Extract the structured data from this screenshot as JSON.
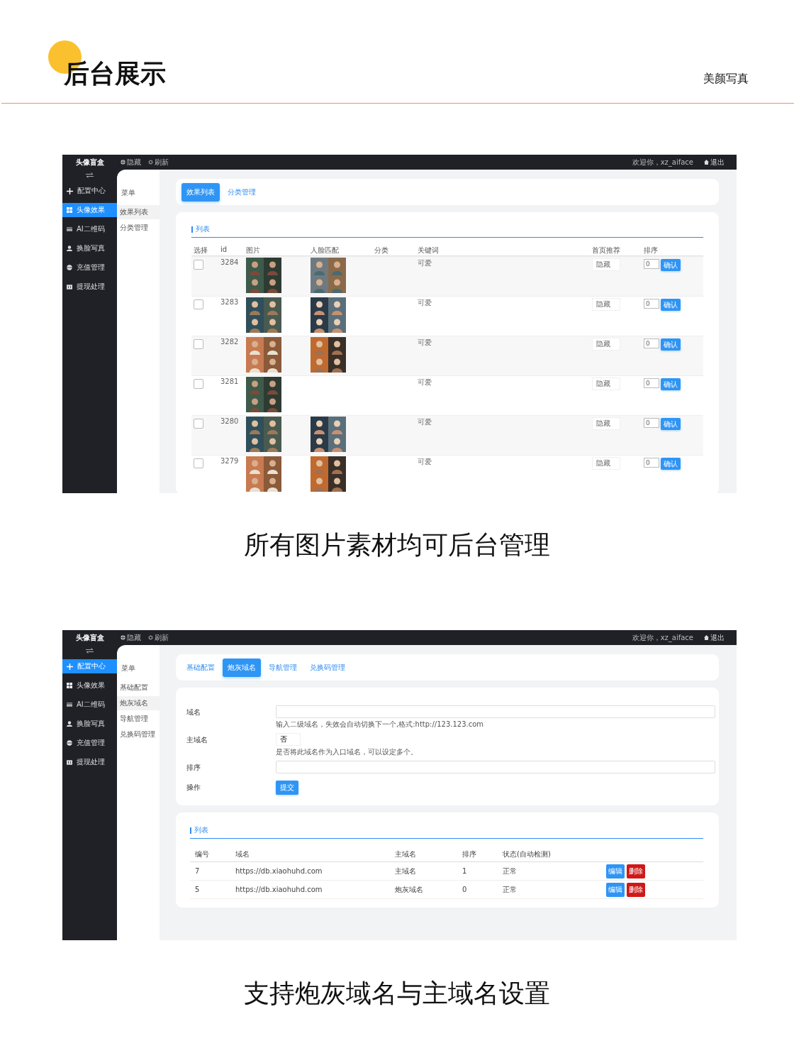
{
  "header": {
    "title": "后台展示",
    "tag": "美颜写真"
  },
  "sections": [
    {
      "caption": "所有图片素材均可后台管理",
      "screen": {
        "brand": "头像盲盒",
        "toolbar": [
          "隐藏",
          "刷新"
        ],
        "welcome": "欢迎你，xz_aiface",
        "logout": "退出",
        "sidebar": [
          {
            "label": "配置中心",
            "selected": false
          },
          {
            "label": "头像效果",
            "selected": true
          },
          {
            "label": "AI二维码",
            "selected": false
          },
          {
            "label": "换脸写真",
            "selected": false
          },
          {
            "label": "充值管理",
            "selected": false
          },
          {
            "label": "提现处理",
            "selected": false
          }
        ],
        "submenu": {
          "title": "菜单",
          "items": [
            {
              "label": "效果列表",
              "selected": true
            },
            {
              "label": "分类管理",
              "selected": false
            }
          ]
        },
        "tabs": [
          {
            "label": "效果列表",
            "selected": true
          },
          {
            "label": "分类管理",
            "selected": false
          }
        ],
        "content": {
          "kind": "gallery",
          "title": "列表",
          "columns": [
            "选择",
            "id",
            "图片",
            "人脸匹配",
            "分类",
            "关键词",
            "首页推荐",
            "排序"
          ],
          "rows": [
            {
              "checked": false,
              "id": "3284",
              "keyword": "可爱",
              "recommend": "隐藏",
              "sort": "0",
              "action": "确认"
            },
            {
              "checked": false,
              "id": "3283",
              "keyword": "可爱",
              "recommend": "隐藏",
              "sort": "0",
              "action": "确认"
            },
            {
              "checked": false,
              "id": "3282",
              "keyword": "可爱",
              "recommend": "隐藏",
              "sort": "0",
              "action": "确认"
            },
            {
              "checked": false,
              "id": "3281",
              "keyword": "可爱",
              "recommend": "隐藏",
              "sort": "0",
              "action": "确认"
            },
            {
              "checked": false,
              "id": "3280",
              "keyword": "可爱",
              "recommend": "隐藏",
              "sort": "0",
              "action": "确认"
            },
            {
              "checked": false,
              "id": "3279",
              "keyword": "可爱",
              "recommend": "隐藏",
              "sort": "0",
              "action": "确认"
            }
          ]
        }
      }
    },
    {
      "caption": "支持炮灰域名与主域名设置",
      "screen": {
        "brand": "头像盲盒",
        "toolbar": [
          "隐藏",
          "刷新"
        ],
        "welcome": "欢迎你，xz_aiface",
        "logout": "退出",
        "sidebar": [
          {
            "label": "配置中心",
            "selected": true
          },
          {
            "label": "头像效果",
            "selected": false
          },
          {
            "label": "AI二维码",
            "selected": false
          },
          {
            "label": "换脸写真",
            "selected": false
          },
          {
            "label": "充值管理",
            "selected": false
          },
          {
            "label": "提现处理",
            "selected": false
          }
        ],
        "submenu": {
          "title": "菜单",
          "items": [
            {
              "label": "基础配置",
              "selected": false
            },
            {
              "label": "炮灰域名",
              "selected": true
            },
            {
              "label": "导航管理",
              "selected": false
            },
            {
              "label": "兑换码管理",
              "selected": false
            }
          ]
        },
        "tabs": [
          {
            "label": "基础配置",
            "selected": false
          },
          {
            "label": "炮灰域名",
            "selected": true
          },
          {
            "label": "导航管理",
            "selected": false
          },
          {
            "label": "兑换码管理",
            "selected": false
          }
        ],
        "content": {
          "kind": "domains",
          "form": [
            {
              "kind": "input",
              "label": "域名",
              "hint": "输入二级域名，失效会自动切换下一个,格式:http://123.123.com"
            },
            {
              "kind": "select",
              "label": "主域名",
              "value": "否",
              "hint": "是否将此域名作为入口域名，可以设定多个。"
            },
            {
              "kind": "input",
              "label": "排序"
            },
            {
              "kind": "button",
              "label": "操作",
              "button": "提交"
            }
          ],
          "title": "列表",
          "columns": [
            "编号",
            "域名",
            "主域名",
            "排序",
            "状态(自动检测)"
          ],
          "rows": [
            {
              "no": "7",
              "domain": "https://db.xiaohuhd.com",
              "type": "主域名",
              "sort": "1",
              "status": "正常",
              "actions": [
                {
                  "kind": "edit",
                  "label": "编辑"
                },
                {
                  "kind": "delete",
                  "label": "删除"
                }
              ]
            },
            {
              "no": "5",
              "domain": "https://db.xiaohuhd.com",
              "type": "炮灰域名",
              "sort": "0",
              "status": "正常",
              "actions": [
                {
                  "kind": "edit",
                  "label": "编辑"
                },
                {
                  "kind": "delete",
                  "label": "删除"
                }
              ]
            }
          ]
        }
      }
    }
  ]
}
